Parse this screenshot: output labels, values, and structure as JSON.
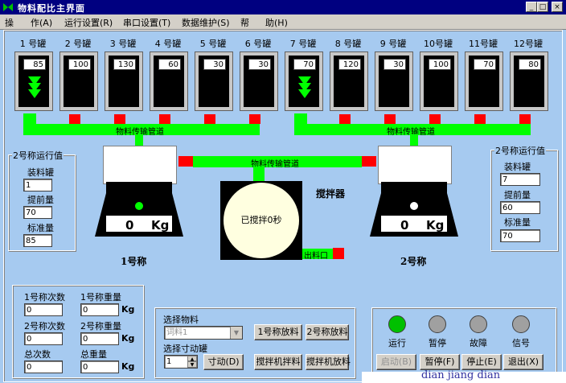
{
  "window": {
    "title": "物料配比主界面"
  },
  "menu": [
    "操",
    "作(A)",
    "运行设置(R)",
    "串口设置(T)",
    "数据维护(S)",
    "帮",
    "助(H)"
  ],
  "tanks": [
    {
      "label": "1 号罐",
      "value": "85"
    },
    {
      "label": "2 号罐",
      "value": "100"
    },
    {
      "label": "3 号罐",
      "value": "130"
    },
    {
      "label": "4 号罐",
      "value": "60"
    },
    {
      "label": "5 号罐",
      "value": "30"
    },
    {
      "label": "6 号罐",
      "value": "30"
    },
    {
      "label": "7 号罐",
      "value": "70"
    },
    {
      "label": "8 号罐",
      "value": "120"
    },
    {
      "label": "9 号罐",
      "value": "30"
    },
    {
      "label": "10号罐",
      "value": "100"
    },
    {
      "label": "11号罐",
      "value": "70"
    },
    {
      "label": "12号罐",
      "value": "80"
    }
  ],
  "pipes": {
    "label": "物料传输管道"
  },
  "left_run": {
    "title": "2号称运行值",
    "tank_label": "装料罐",
    "tank_value": "1",
    "pre_label": "提前量",
    "pre_value": "70",
    "std_label": "标准量",
    "std_value": "85"
  },
  "right_run": {
    "title": "2号称运行值",
    "tank_label": "装料罐",
    "tank_value": "7",
    "pre_label": "提前量",
    "pre_value": "60",
    "std_label": "标准量",
    "std_value": "70"
  },
  "scale1": {
    "reading": "0",
    "unit": "Kg",
    "name": "1号称"
  },
  "scale2": {
    "reading": "0",
    "unit": "Kg",
    "name": "2号称"
  },
  "mixer": {
    "title": "搅拌器",
    "status": "已搅拌0秒",
    "outlet": "出料口"
  },
  "stats": {
    "s1_count_label": "1号称次数",
    "s1_count": "0",
    "s1_weight_label": "1号称重量",
    "s1_weight": "0",
    "s2_count_label": "2号称次数",
    "s2_count": "0",
    "s2_weight_label": "2号称重量",
    "s2_weight": "0",
    "total_count_label": "总次数",
    "total_count": "0",
    "total_weight_label": "总重量",
    "total_weight": "0",
    "unit": "Kg"
  },
  "material": {
    "title": "选择物料",
    "selected": "词料1",
    "jog_title": "选择寸动罐",
    "jog_value": "1",
    "jog_btn": "寸动(D)",
    "s1_discharge": "1号称放料",
    "s2_discharge": "2号称放料",
    "mixer_mix": "搅拌机拌料",
    "mixer_discharge": "搅拌机放料"
  },
  "status": {
    "run": "运行",
    "pause": "暂停",
    "fault": "故障",
    "signal": "信号",
    "start_btn": "启动(B)",
    "pause_btn": "暂停(F)",
    "stop_btn": "停止(E)",
    "exit_btn": "退出(X)",
    "colors": {
      "run": "#00c000",
      "off": "#a0a0a0"
    }
  },
  "bottom_text": "dian jiang dian"
}
